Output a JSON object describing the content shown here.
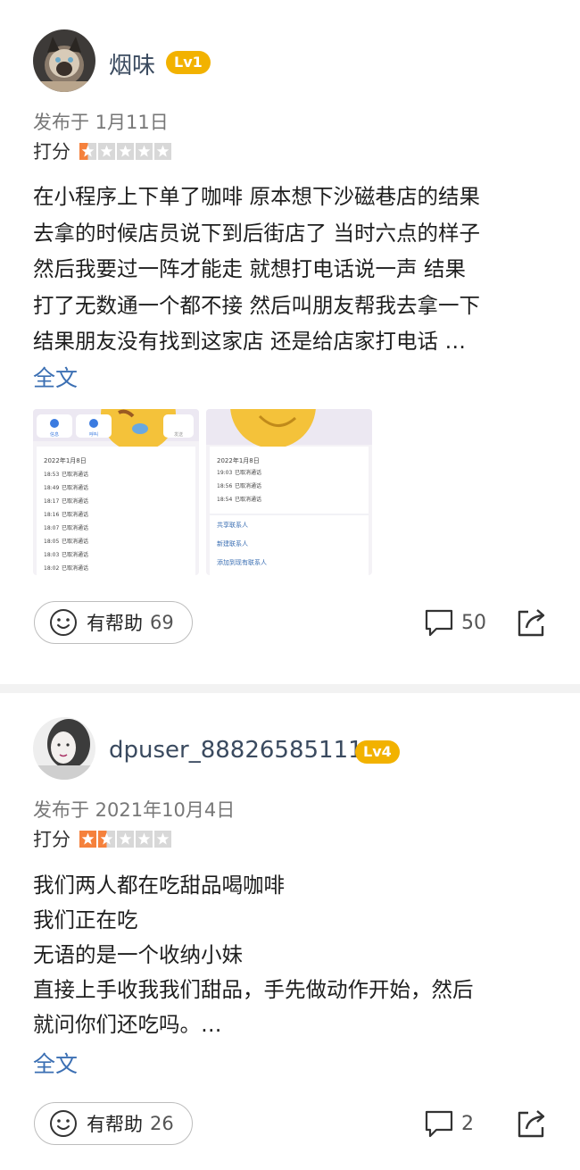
{
  "reviews": [
    {
      "username": "烟味",
      "level": "Lv1",
      "published": "发布于 1月11日",
      "rating_label": "打分",
      "rating": 0.5,
      "body_lines": [
        "在小程序上下单了咖啡 原本想下沙磁巷店的结果",
        "去拿的时候店员说下到后街店了 当时六点的样子",
        "然后我要过一阵才能走 就想打电话说一声 结果",
        "打了无数通一个都不接 然后叫朋友帮我去拿一下",
        "结果朋友没有找到这家店 还是给店家打电话 …"
      ],
      "full_text_link": "全文",
      "photos": [
        {
          "tabs": [
            "信息",
            "呼叫",
            "发送"
          ],
          "date": "2022年1月8日",
          "calls": [
            {
              "time": "18:53",
              "status": "已取消通话"
            },
            {
              "time": "18:49",
              "status": "已取消通话"
            },
            {
              "time": "18:17",
              "status": "已取消通话"
            },
            {
              "time": "18:16",
              "status": "已取消通话"
            },
            {
              "time": "18:07",
              "status": "已取消通话"
            },
            {
              "time": "18:05",
              "status": "已取消通话"
            },
            {
              "time": "18:03",
              "status": "已取消通话"
            },
            {
              "time": "18:02",
              "status": "已取消通话"
            }
          ]
        },
        {
          "date": "2022年1月8日",
          "calls": [
            {
              "time": "19:03",
              "status": "已取消通话"
            },
            {
              "time": "18:56",
              "status": "已取消通话"
            },
            {
              "time": "18:54",
              "status": "已取消通话"
            }
          ],
          "actions": [
            "共享联系人",
            "新建联系人",
            "添加到现有联系人"
          ]
        }
      ],
      "helpful_label": "有帮助",
      "helpful_count": "69",
      "comment_count": "50"
    },
    {
      "username": "dpuser_88826585111",
      "level": "Lv4",
      "published": "发布于 2021年10月4日",
      "rating_label": "打分",
      "rating": 1.5,
      "body_lines": [
        "我们两人都在吃甜品喝咖啡",
        "我们正在吃",
        "无语的是一个收纳小妹",
        "直接上手收我我们甜品，手先做动作开始，然后",
        "就问你们还吃吗。…"
      ],
      "full_text_link": "全文",
      "helpful_label": "有帮助",
      "helpful_count": "26",
      "comment_count": "2"
    }
  ],
  "colors": {
    "accent_link": "#3b6fb3",
    "badge": "#f2b200",
    "star_filled": "#f5813c",
    "star_empty": "#d8d8d8"
  },
  "icons": [
    "smile-icon",
    "comment-icon",
    "share-icon",
    "star-icon"
  ]
}
